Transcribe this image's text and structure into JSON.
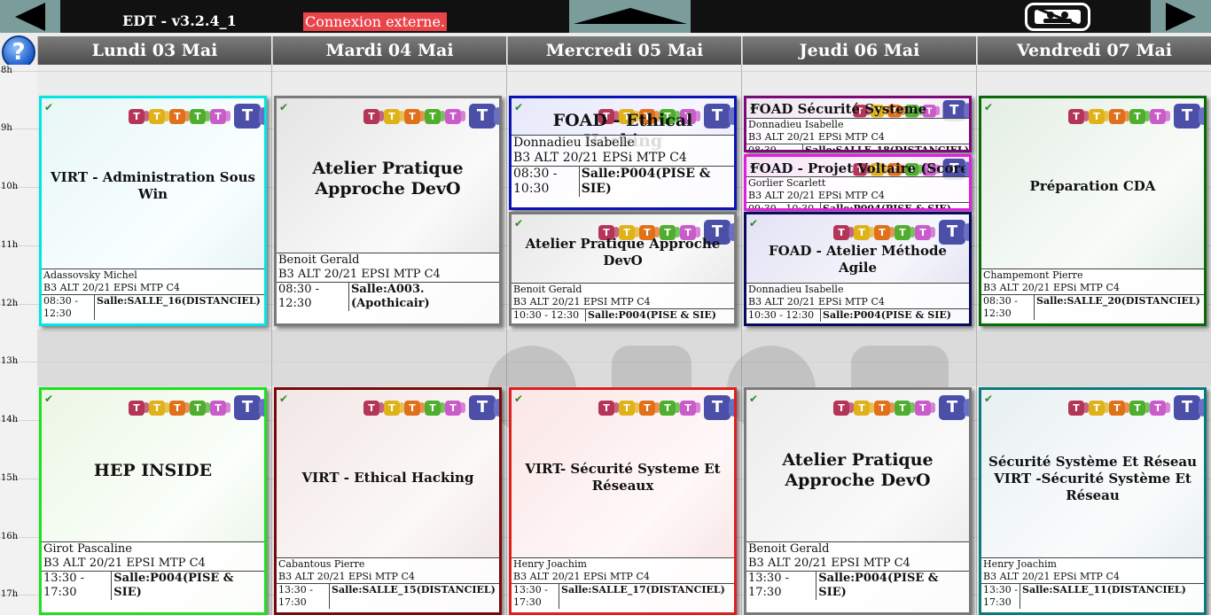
{
  "app": {
    "title": "EDT - v3.2.4_1",
    "external_label": "Connexion externe.",
    "help_label": "?"
  },
  "nav": {
    "prev_icon": "arrow-left-icon",
    "next_icon": "arrow-right-icon",
    "up_icon": "arrow-up-icon",
    "display_icon": "no-photo-display-icon"
  },
  "days": [
    "Lundi 03 Mai",
    "Mardi 04 Mai",
    "Mercredi 05 Mai",
    "Jeudi 06 Mai",
    "Vendredi 07 Mai"
  ],
  "hours": [
    "8h",
    "9h",
    "10h",
    "11h",
    "12h",
    "13h",
    "14h",
    "15h",
    "16h",
    "17h"
  ],
  "colors": {
    "teams_icons": [
      "#b53558",
      "#e0b21a",
      "#e0701a",
      "#4fae2e",
      "#c95cc9"
    ],
    "teams_main": "#4b4fa8"
  },
  "events": [
    {
      "title": "VIRT - Administration Sous Win",
      "teacher": "Adassovsky Michel",
      "group": "B3 ALT 20/21 EPSi MTP C4",
      "time": "08:30 - 12:30",
      "room": "Salle:SALLE_16(DISTANCIEL)",
      "border": "#00e5e5"
    },
    {
      "title": "Atelier Pratique Approche DevO",
      "teacher": "Benoit Gerald",
      "group": "B3 ALT 20/21 EPSI MTP C4",
      "time": "08:30 - 12:30",
      "room": "Salle:A003.(Apothicair)",
      "border": "#7a7a7a"
    },
    {
      "title": "FOAD - Ethical Hacking",
      "teacher": "Donnadieu Isabelle",
      "group": "B3 ALT 20/21 EPSi MTP C4",
      "time": "08:30 - 10:30",
      "room": "Salle:P004(PISE & SIE)",
      "border": "#0a14b4"
    },
    {
      "title": "Atelier Pratique Approche DevO",
      "teacher": "Benoit Gerald",
      "group": "B3 ALT 20/21 EPSI MTP C4",
      "time": "10:30 - 12:30",
      "room": "Salle:P004(PISE & SIE)",
      "border": "#7a7a7a"
    },
    {
      "title": "FOAD Sécurité Systeme",
      "teacher": "Donnadieu Isabelle",
      "group": "B3 ALT 20/21 EPSi MTP C4",
      "time": "08:30 - 09:30",
      "room": "Salle:SALLE_18(DISTANCIEL)",
      "border": "#7a0a7a"
    },
    {
      "title": "FOAD - Projet Voltaire (Score",
      "teacher": "Gorlier Scarlett",
      "group": "B3 ALT 20/21 EPSi MTP C4",
      "time": "09:30 - 10:30",
      "room": "Salle:P004(PISE & SIE)",
      "border": "#e01ee0"
    },
    {
      "title": "FOAD - Atelier Méthode Agile",
      "teacher": "Donnadieu Isabelle",
      "group": "B3 ALT 20/21 EPSi MTP C4",
      "time": "10:30 - 12:30",
      "room": "Salle:P004(PISE & SIE)",
      "border": "#0a0a5a"
    },
    {
      "title": "Préparation CDA",
      "teacher": "Champemont Pierre",
      "group": "B3 ALT 20/21 EPSi MTP C4",
      "time": "08:30 - 12:30",
      "room": "Salle:SALLE_20(DISTANCIEL)",
      "border": "#0a6a0a"
    },
    {
      "title": "HEP INSIDE",
      "teacher": "Girot Pascaline",
      "group": "B3 ALT 20/21 EPSI MTP C4",
      "time": "13:30 - 17:30",
      "room": "Salle:P004(PISE & SIE)",
      "border": "#1ee01e"
    },
    {
      "title": "VIRT - Ethical Hacking",
      "teacher": "Cabantous Pierre",
      "group": "B3 ALT 20/21 EPSi MTP C4",
      "time": "13:30 - 17:30",
      "room": "Salle:SALLE_15(DISTANCIEL)",
      "border": "#7a0a0a"
    },
    {
      "title": "VIRT- Sécurité Systeme Et Réseaux",
      "teacher": "Henry Joachim",
      "group": "B3 ALT 20/21 EPSi MTP C4",
      "time": "13:30 - 17:30",
      "room": "Salle:SALLE_17(DISTANCIEL)",
      "border": "#e01e1e"
    },
    {
      "title": "Atelier Pratique Approche DevO",
      "teacher": "Benoit Gerald",
      "group": "B3 ALT 20/21 EPSI MTP C4",
      "time": "13:30 - 17:30",
      "room": "Salle:P004(PISE & SIE)",
      "border": "#7a7a7a"
    },
    {
      "title": "Sécurité Système Et Réseau VIRT -Sécurité Système Et Réseau",
      "teacher": "Henry Joachim",
      "group": "B3 ALT 20/21 EPSi MTP C4",
      "time": "13:30 - 17:30",
      "room": "Salle:SALLE_11(DISTANCIEL)",
      "border": "#0a7a7a"
    }
  ]
}
